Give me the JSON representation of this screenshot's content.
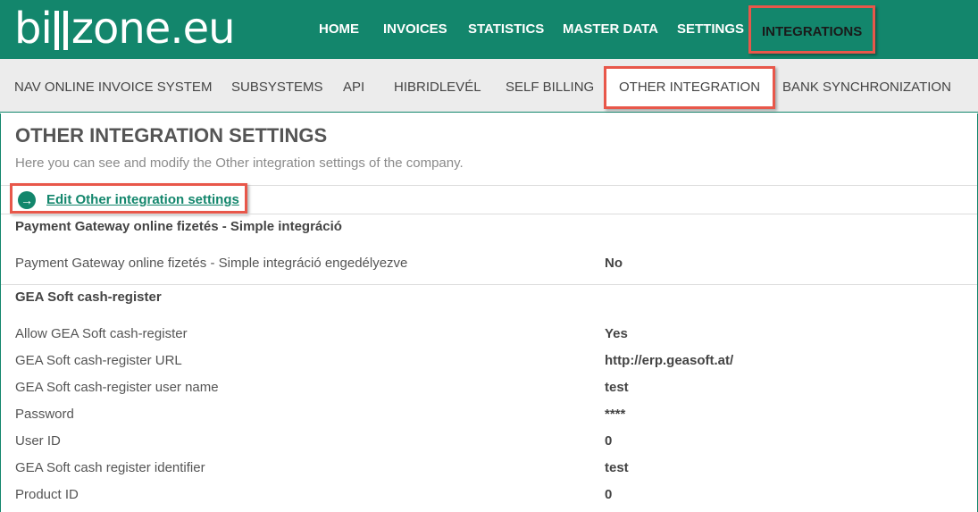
{
  "brand": {
    "logo_pre": "bi",
    "logo_post": "zone.eu"
  },
  "main_nav": [
    {
      "label": "HOME"
    },
    {
      "label": "INVOICES"
    },
    {
      "label": "STATISTICS"
    },
    {
      "label": "MASTER DATA"
    },
    {
      "label": "SETTINGS"
    },
    {
      "label": "INTEGRATIONS",
      "active": true
    }
  ],
  "sub_nav": [
    {
      "label": "NAV ONLINE INVOICE SYSTEM"
    },
    {
      "label": "SUBSYSTEMS"
    },
    {
      "label": "API"
    },
    {
      "label": "HIBRIDLEVÉL"
    },
    {
      "label": "SELF BILLING"
    },
    {
      "label": "OTHER INTEGRATION",
      "active": true
    },
    {
      "label": "BANK SYNCHRONIZATION"
    }
  ],
  "page": {
    "title": "OTHER INTEGRATION SETTINGS",
    "description": "Here you can see and modify the Other integration settings of the company.",
    "edit_link": "Edit Other integration settings"
  },
  "sections": [
    {
      "title": "Payment Gateway online fizetés - Simple integráció",
      "rows": [
        {
          "label": "Payment Gateway online fizetés - Simple integráció engedélyezve",
          "value": "No"
        }
      ]
    },
    {
      "title": "GEA Soft cash-register",
      "rows": [
        {
          "label": "Allow GEA Soft cash-register",
          "value": "Yes"
        },
        {
          "label": "GEA Soft cash-register URL",
          "value": "http://erp.geasoft.at/"
        },
        {
          "label": "GEA Soft cash-register user name",
          "value": "test"
        },
        {
          "label": "Password",
          "value": "****"
        },
        {
          "label": "User ID",
          "value": "0"
        },
        {
          "label": "GEA Soft cash register identifier",
          "value": "test"
        },
        {
          "label": "Product ID",
          "value": "0"
        }
      ]
    }
  ],
  "colors": {
    "brand_green": "#13866c",
    "highlight_red": "#e8574a",
    "subnav_bg": "#ececec"
  }
}
